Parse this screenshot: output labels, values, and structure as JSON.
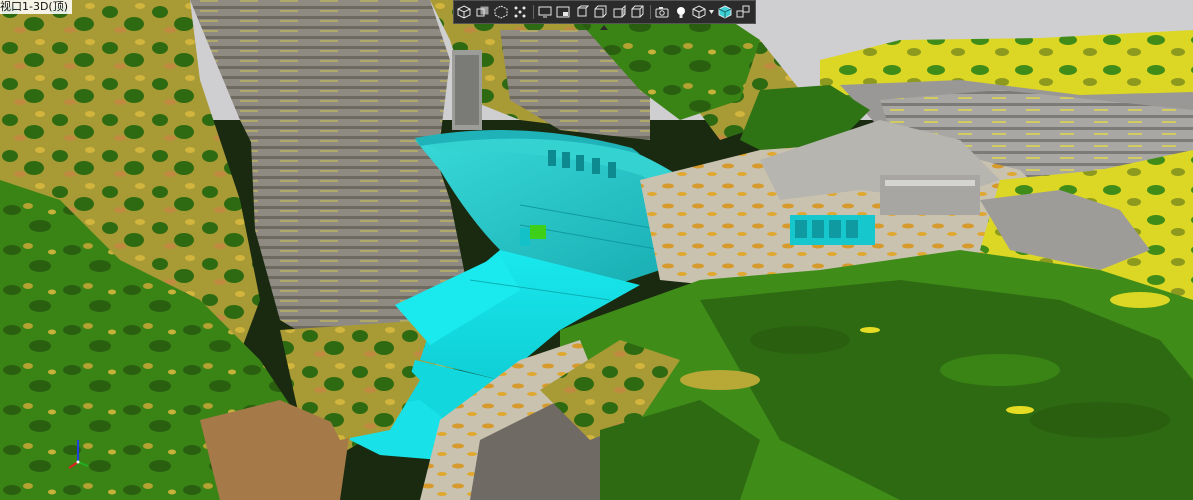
{
  "viewport": {
    "title": "视口1-3D(顶)",
    "mode": "3D"
  },
  "toolbar": {
    "buttons": [
      {
        "name": "view-cube-solid-button",
        "icon": "cube-solid-icon"
      },
      {
        "name": "view-cube-multi-button",
        "icon": "cube-stack-icon"
      },
      {
        "name": "view-cube-wire-button",
        "icon": "cube-wireframe-icon"
      },
      {
        "name": "view-cube-points-button",
        "icon": "cube-points-icon"
      },
      {
        "name": "view-monitor-button",
        "icon": "monitor-icon"
      },
      {
        "name": "view-window-button",
        "icon": "window-icon"
      },
      {
        "name": "view-box-top-button",
        "icon": "box-top-icon"
      },
      {
        "name": "view-box-front-button",
        "icon": "box-front-icon"
      },
      {
        "name": "view-box-side-button",
        "icon": "box-side-icon"
      },
      {
        "name": "view-box-iso-button",
        "icon": "box-iso-icon"
      },
      {
        "name": "view-camera-button",
        "icon": "camera-icon"
      },
      {
        "name": "view-light-button",
        "icon": "light-bulb-icon"
      },
      {
        "name": "view-render-mode-button",
        "icon": "cube-outline-icon"
      },
      {
        "name": "view-shaded-button",
        "icon": "cube-shaded-icon"
      },
      {
        "name": "view-cube-split-button",
        "icon": "cube-split-icon"
      }
    ],
    "colors": {
      "background": "#2b2b2b",
      "icon": "#e6e6e6",
      "accent": "#3fd0d6"
    }
  },
  "scene": {
    "colors": {
      "sky": "#d0d0d2",
      "vegetation_dark": "#2e6a12",
      "vegetation": "#3f8c19",
      "terrain_yellow": "#b6a235",
      "terrain_bright_yellow": "#e8e020",
      "terrain_orange": "#d29a2a",
      "rock_grey": "#8c8a86",
      "rock_light": "#b4b2ae",
      "dam_cyan": "#1ac8c8",
      "dam_bright": "#16e6ea",
      "highlight_green": "#3ed018"
    }
  },
  "axis_gizmo": {
    "x_color": "#e02020",
    "y_color": "#20b020",
    "z_color": "#2040e0"
  }
}
